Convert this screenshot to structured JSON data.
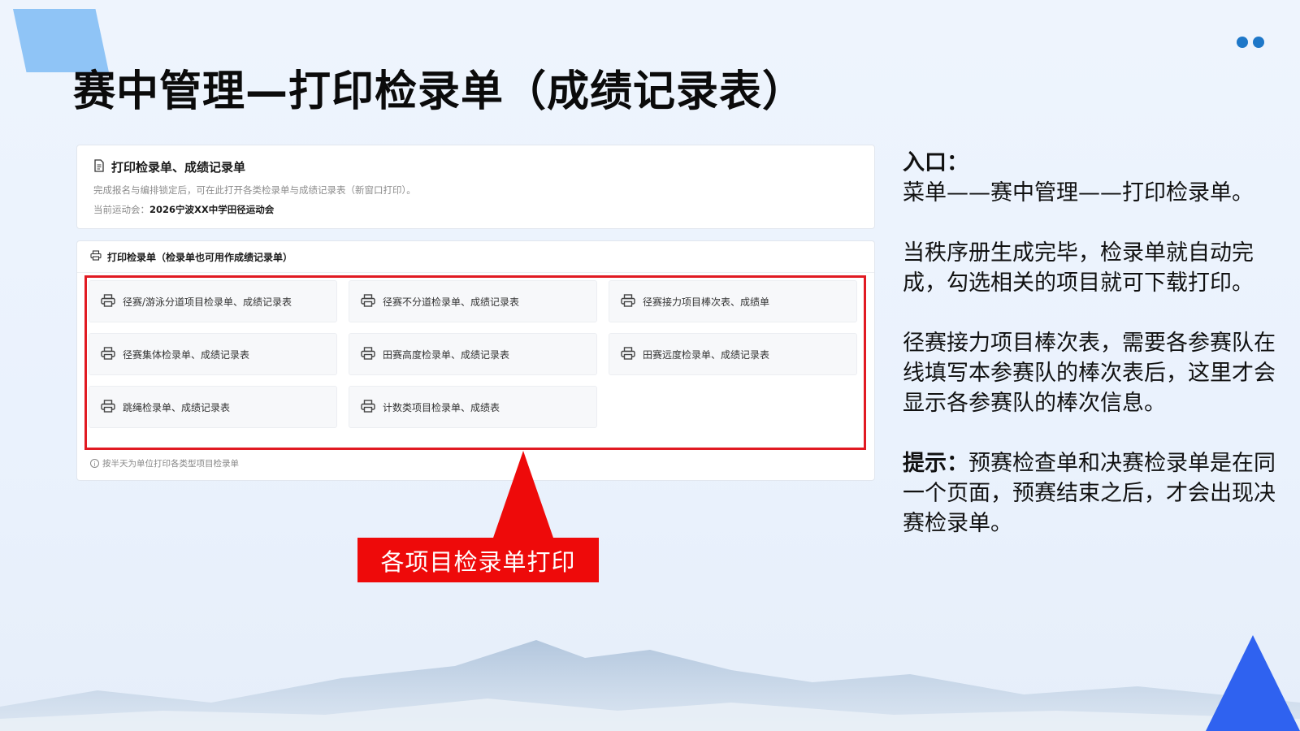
{
  "slide": {
    "title": "赛中管理—打印检录单（成绩记录表）"
  },
  "panel_top": {
    "heading": "打印检录单、成绩记录单",
    "description": "完成报名与编排锁定后，可在此打开各类检录单与成绩记录表（新窗口打印）。",
    "meet_label": "当前运动会：",
    "meet_name": "2026宁波XX中学田径运动会"
  },
  "panel_main": {
    "header": "打印检录单（检录单也可用作成绩记录单）",
    "items": [
      {
        "label": "径赛/游泳分道项目检录单、成绩记录表"
      },
      {
        "label": "径赛不分道检录单、成绩记录表"
      },
      {
        "label": "径赛接力项目棒次表、成绩单"
      },
      {
        "label": "径赛集体检录单、成绩记录表"
      },
      {
        "label": "田赛高度检录单、成绩记录表"
      },
      {
        "label": "田赛远度检录单、成绩记录表"
      },
      {
        "label": "跳绳检录单、成绩记录表"
      },
      {
        "label": "计数类项目检录单、成绩表"
      }
    ],
    "footer_note": "按半天为单位打印各类型项目检录单"
  },
  "callout": {
    "text": "各项目检录单打印"
  },
  "right_text": {
    "entry_label": "入口：",
    "entry_path": "菜单——赛中管理——打印检录单。",
    "para1": "当秩序册生成完毕，检录单就自动完成，勾选相关的项目就可下载打印。",
    "para2": "径赛接力项目棒次表，需要各参赛队在线填写本参赛队的棒次表后，这里才会显示各参赛队的棒次信息。",
    "tip_label": "提示：",
    "tip_text": "预赛检查单和决赛检录单是在同一个页面，预赛结束之后，才会出现决赛检录单。"
  },
  "colors": {
    "highlight_red": "#e11a22",
    "callout_red": "#ee0a0a",
    "accent_blue": "#2f62f0",
    "light_blue": "#8fc4f6",
    "dot_blue": "#1e77c8"
  }
}
